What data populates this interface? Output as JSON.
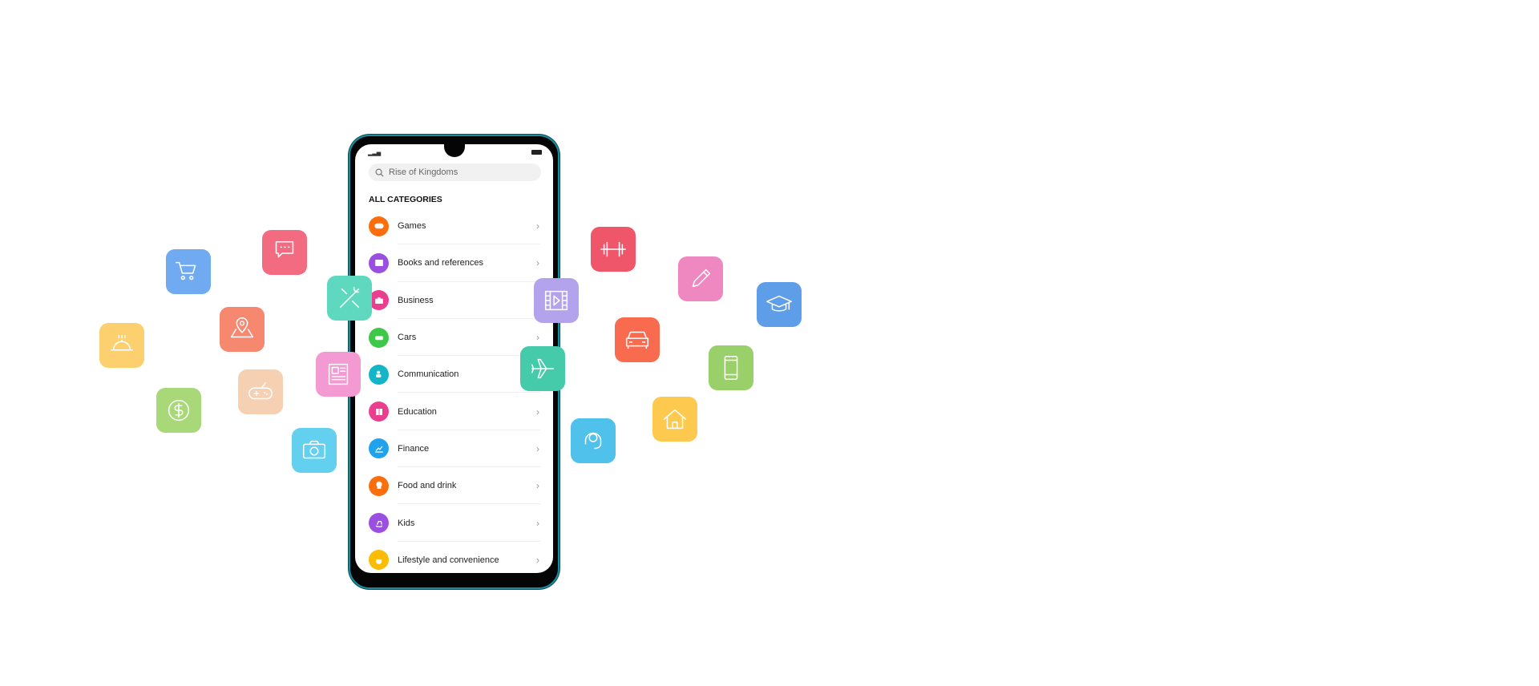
{
  "phone": {
    "search": {
      "placeholder": "Rise of Kingdoms",
      "icon": "search-icon"
    },
    "heading": "ALL CATEGORIES",
    "categories": [
      {
        "label": "Games",
        "color": "#fb6e0e",
        "icon": "gamepad-icon"
      },
      {
        "label": "Books and references",
        "color": "#9b4fe0",
        "icon": "book-icon"
      },
      {
        "label": "Business",
        "color": "#ea3f8f",
        "icon": "briefcase-icon"
      },
      {
        "label": "Cars",
        "color": "#3fc74a",
        "icon": "car-icon"
      },
      {
        "label": "Communication",
        "color": "#14b5c7",
        "icon": "contacts-icon"
      },
      {
        "label": "Education",
        "color": "#ea3f8f",
        "icon": "open-book-icon"
      },
      {
        "label": "Finance",
        "color": "#1fa3ec",
        "icon": "chart-icon"
      },
      {
        "label": "Food and drink",
        "color": "#fb6e0e",
        "icon": "chef-hat-icon"
      },
      {
        "label": "Kids",
        "color": "#9b4fe0",
        "icon": "rocking-horse-icon"
      },
      {
        "label": "Lifestyle and convenience",
        "color": "#fbbc05",
        "icon": "coffee-icon"
      }
    ]
  },
  "floating_icons": [
    {
      "icon": "shopping-cart-icon",
      "color": "#70aaf1"
    },
    {
      "icon": "chat-bubble-icon",
      "color": "#f36b80"
    },
    {
      "icon": "food-cloche-icon",
      "color": "#fcd06e"
    },
    {
      "icon": "map-pin-icon",
      "color": "#f78870"
    },
    {
      "icon": "tools-icon",
      "color": "#5fd8c0"
    },
    {
      "icon": "dollar-icon",
      "color": "#a9d879"
    },
    {
      "icon": "gamepad-icon",
      "color": "#f5d0b2"
    },
    {
      "icon": "newspaper-icon",
      "color": "#f29ad1"
    },
    {
      "icon": "camera-icon",
      "color": "#62d0ee"
    },
    {
      "icon": "video-icon",
      "color": "#b3a3ec"
    },
    {
      "icon": "airplane-icon",
      "color": "#45cba9"
    },
    {
      "icon": "dumbbell-icon",
      "color": "#f0566a"
    },
    {
      "icon": "car-icon",
      "color": "#f96b4f"
    },
    {
      "icon": "headset-icon",
      "color": "#4fc1ea"
    },
    {
      "icon": "pencil-icon",
      "color": "#ef88c0"
    },
    {
      "icon": "home-icon",
      "color": "#fdc94e"
    },
    {
      "icon": "smartphone-icon",
      "color": "#9ad06a"
    },
    {
      "icon": "graduation-cap-icon",
      "color": "#5e9ee8"
    }
  ]
}
